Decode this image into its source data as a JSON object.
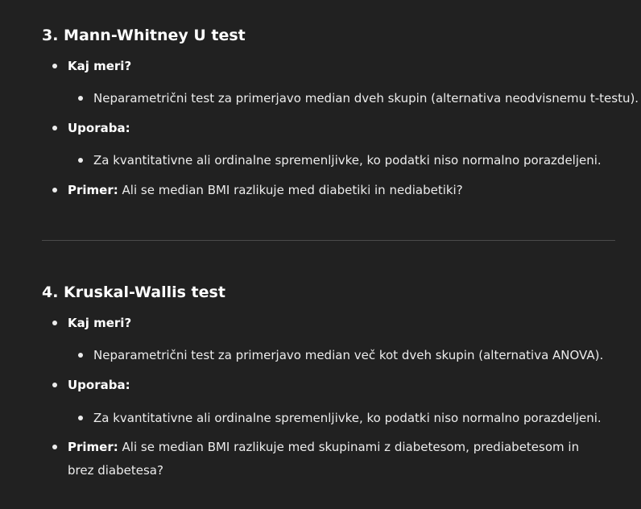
{
  "sections": [
    {
      "title": "3. Mann-Whitney U test",
      "items": [
        {
          "label": "Kaj meri?",
          "sub": "Neparametrični test za primerjavo median dveh skupin (alternativa neodvisnemu t-testu)."
        },
        {
          "label": "Uporaba:",
          "sub": "Za kvantitativne ali ordinalne spremenljivke, ko podatki niso normalno porazdeljeni."
        },
        {
          "label": "Primer:",
          "text": "Ali se median BMI razlikuje med diabetiki in nediabetiki?"
        }
      ]
    },
    {
      "title": "4. Kruskal-Wallis test",
      "items": [
        {
          "label": "Kaj meri?",
          "sub": "Neparametrični test za primerjavo median več kot dveh skupin (alternativa ANOVA)."
        },
        {
          "label": "Uporaba:",
          "sub": "Za kvantitativne ali ordinalne spremenljivke, ko podatki niso normalno porazdeljeni."
        },
        {
          "label": "Primer:",
          "text": "Ali se median BMI razlikuje med skupinami z diabetesom, prediabetesom in brez diabetesa?"
        }
      ]
    }
  ]
}
